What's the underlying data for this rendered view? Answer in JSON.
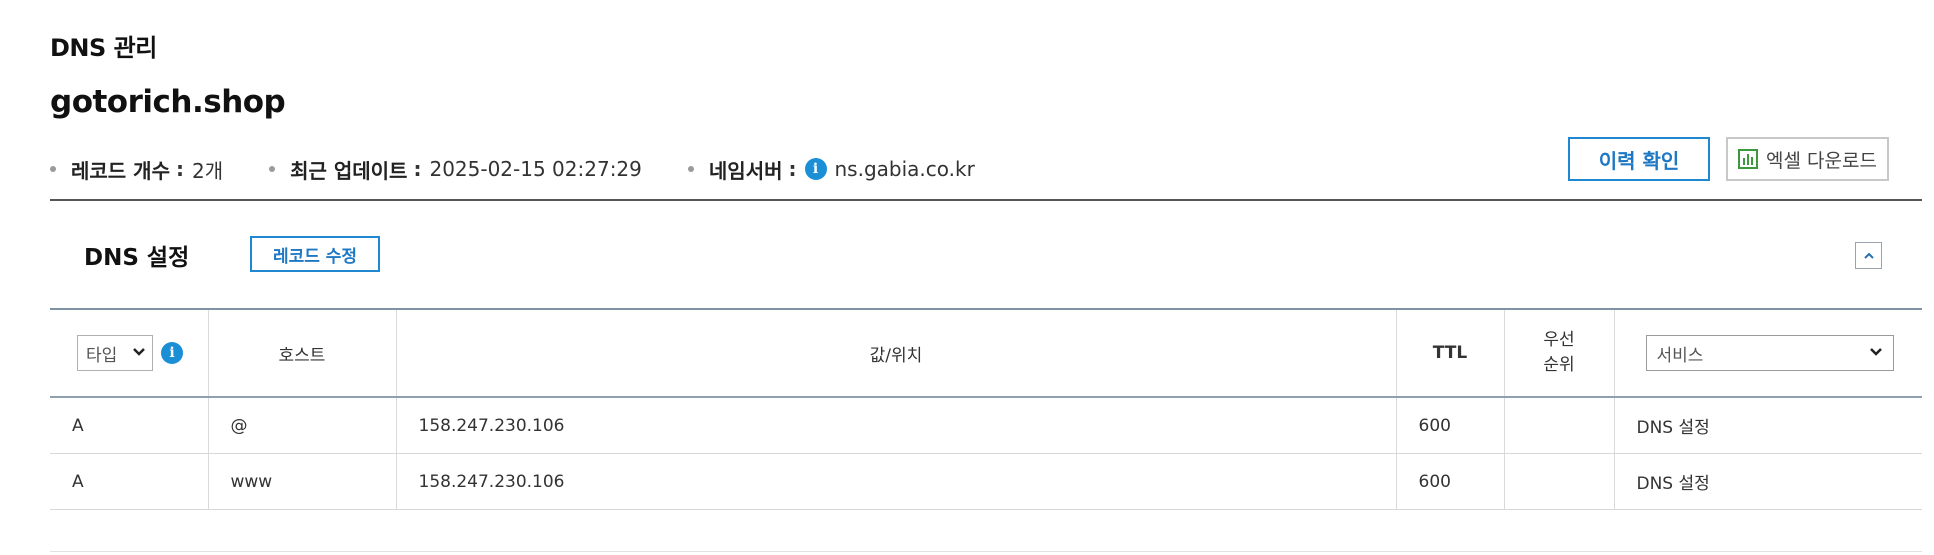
{
  "page": {
    "label": "DNS 관리",
    "domain": "gotorich.shop"
  },
  "meta": {
    "record_count_label": "레코드 개수",
    "record_count_value": "2개",
    "updated_label": "최근 업데이트",
    "updated_value": "2025-02-15 02:27:29",
    "nameserver_label": "네임서버",
    "nameserver_value": "ns.gabia.co.kr",
    "colon": ":"
  },
  "actions": {
    "history": "이력 확인",
    "excel": "엑셀 다운로드",
    "edit_record": "레코드 수정"
  },
  "section": {
    "title": "DNS 설정"
  },
  "table": {
    "headers": {
      "type_select": "타입",
      "host": "호스트",
      "value": "값/위치",
      "ttl": "TTL",
      "priority_line1": "우선",
      "priority_line2": "순위",
      "service_select": "서비스"
    },
    "rows": [
      {
        "type": "A",
        "host": "@",
        "value": "158.247.230.106",
        "ttl": "600",
        "priority": "",
        "service": "DNS 설정"
      },
      {
        "type": "A",
        "host": "www",
        "value": "158.247.230.106",
        "ttl": "600",
        "priority": "",
        "service": "DNS 설정"
      }
    ]
  },
  "icons": {
    "info": "info-icon",
    "excel": "chart-icon",
    "chevron": "chevron-down-icon",
    "collapse": "chevron-up-icon"
  },
  "colors": {
    "accent": "#1f88d0",
    "info": "#1a8fd6",
    "excel_green": "#3c9a3c"
  }
}
